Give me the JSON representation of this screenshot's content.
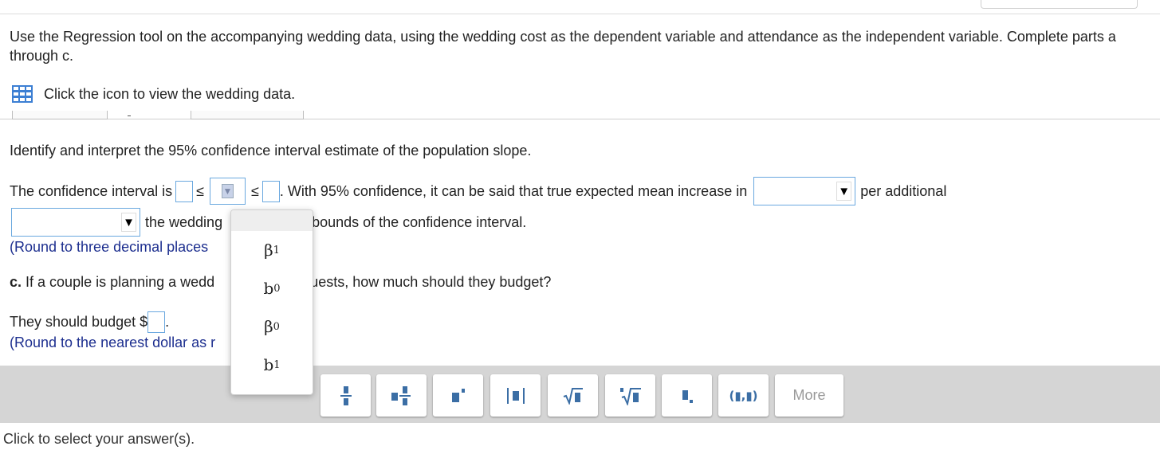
{
  "instructions": "Use the Regression tool on the accompanying wedding data, using the wedding cost as the dependent variable and attendance as the independent variable. Complete parts a through c.",
  "data_link": {
    "text": "Click the icon to view the wedding data.",
    "icon": "table-grid-icon"
  },
  "question": "Identify and interpret the 95% confidence interval estimate of the population slope.",
  "ci_sentence": {
    "lead": "The confidence interval is",
    "le1": "≤",
    "le2": "≤",
    "middle": ". With 95% confidence, it can be said that true expected mean increase in",
    "tail": "per additional",
    "line2_a": "the wedding",
    "line2_b": "bounds of the confidence interval."
  },
  "hint_round3": "(Round to three decimal places",
  "part_c": {
    "label": "c.",
    "text_a": "If a couple is planning a wedd",
    "text_b": "guests, how much should they budget?"
  },
  "budget": {
    "text": "They should budget $",
    "period": "."
  },
  "hint_round_dollar": "(Round to the nearest dollar as r",
  "dropdown_options": [
    {
      "base": "β",
      "sub": "1"
    },
    {
      "base": "b",
      "sub": "0"
    },
    {
      "base": "β",
      "sub": "0"
    },
    {
      "base": "b",
      "sub": "1"
    }
  ],
  "toolbar": {
    "tools": [
      {
        "name": "fraction",
        "glyph": "▪̶▪"
      },
      {
        "name": "mixed-number",
        "glyph": "▪▪̶▪"
      },
      {
        "name": "exponent",
        "glyph": "▪ˑ"
      },
      {
        "name": "absolute-value",
        "glyph": "|▪|"
      },
      {
        "name": "square-root",
        "glyph": "√▪"
      },
      {
        "name": "nth-root",
        "glyph": "ⁿ√▪"
      },
      {
        "name": "subscript",
        "glyph": "▪.",
        "_comment": ""
      },
      {
        "name": "ordered-pair",
        "glyph": "(▪,▪)"
      }
    ],
    "more_label": "More"
  },
  "status_text": "Click to select your answer(s)."
}
